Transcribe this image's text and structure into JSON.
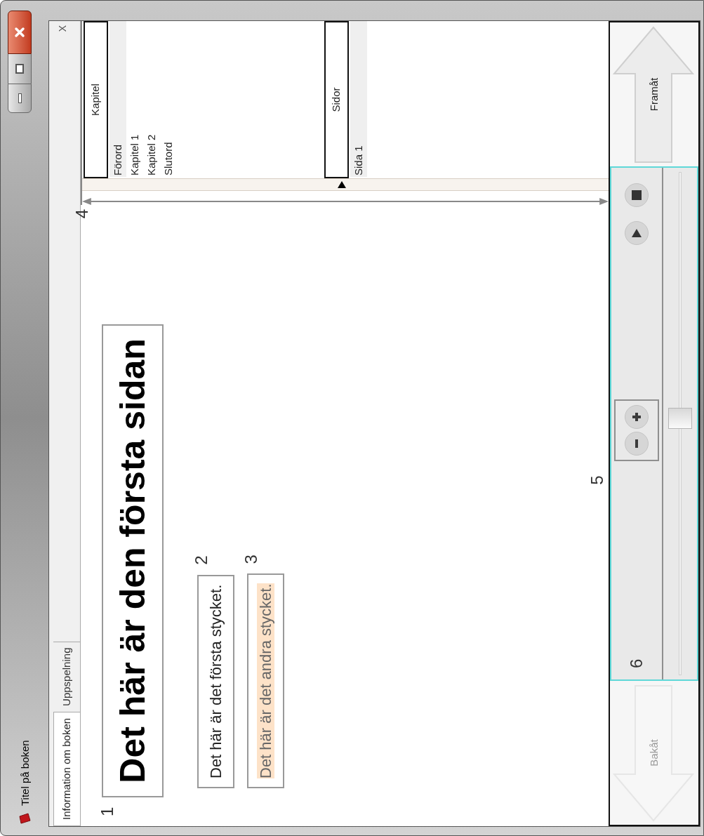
{
  "window": {
    "title": "Titel på boken"
  },
  "tabs": [
    {
      "label": "Information om boken",
      "selected": true
    },
    {
      "label": "Uppspelning",
      "selected": false
    }
  ],
  "panel_close": "X",
  "page": {
    "heading": "Det här är den första sidan",
    "heading_callout": "1",
    "callout_4": "4",
    "paragraphs": [
      {
        "text": "Det här är det första stycket.",
        "callout": "2",
        "highlighted": false
      },
      {
        "text": "Det här är det andra stycket.",
        "callout": "3",
        "highlighted": true
      }
    ]
  },
  "navigation": {
    "sections": [
      {
        "header": "Kapitel",
        "items": [
          {
            "label": "Förord",
            "selected": true
          },
          {
            "label": "Kapitel 1",
            "selected": false
          },
          {
            "label": "Kapitel 2",
            "selected": false
          },
          {
            "label": "Slutord",
            "selected": false
          }
        ]
      },
      {
        "header": "Sidor",
        "items": [
          {
            "label": "Sida 1",
            "selected": true
          }
        ]
      }
    ]
  },
  "controls": {
    "back": {
      "label": "Bakåt",
      "disabled": true
    },
    "forward": {
      "label": "Framåt",
      "disabled": false
    },
    "callout_5": "5",
    "callout_6": "6",
    "slider": {
      "level": 0.51
    }
  }
}
